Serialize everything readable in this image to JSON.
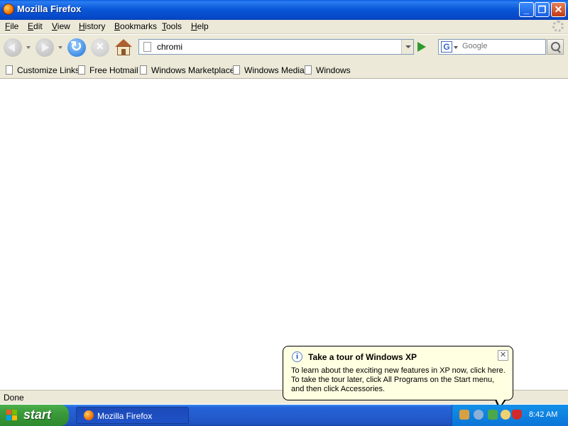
{
  "window": {
    "title": "Mozilla Firefox",
    "minimize": "_",
    "maximize": "❐",
    "close": "✕"
  },
  "menu": [
    "File",
    "Edit",
    "View",
    "History",
    "Bookmarks",
    "Tools",
    "Help"
  ],
  "toolbar": {
    "address_value": "chromi",
    "search_placeholder": "Google",
    "search_engine_letter": "G"
  },
  "bookmarks": [
    "Customize Links",
    "Free Hotmail",
    "Windows Marketplace",
    "Windows Media",
    "Windows"
  ],
  "status": {
    "text": "Done"
  },
  "balloon": {
    "title": "Take a tour of Windows XP",
    "line1": "To learn about the exciting new features in XP now, click here.",
    "line2": "To take the tour later, click All Programs on the Start menu,",
    "line3": "and then click Accessories.",
    "close": "✕",
    "info": "i"
  },
  "taskbar": {
    "start_label": "start",
    "task_label": "Mozilla Firefox",
    "clock": "8:42 AM"
  },
  "colors": {
    "titlebar": "#0a58d8",
    "taskbar": "#245dd0",
    "start_button": "#3a9a3a",
    "balloon": "#ffffe1"
  }
}
